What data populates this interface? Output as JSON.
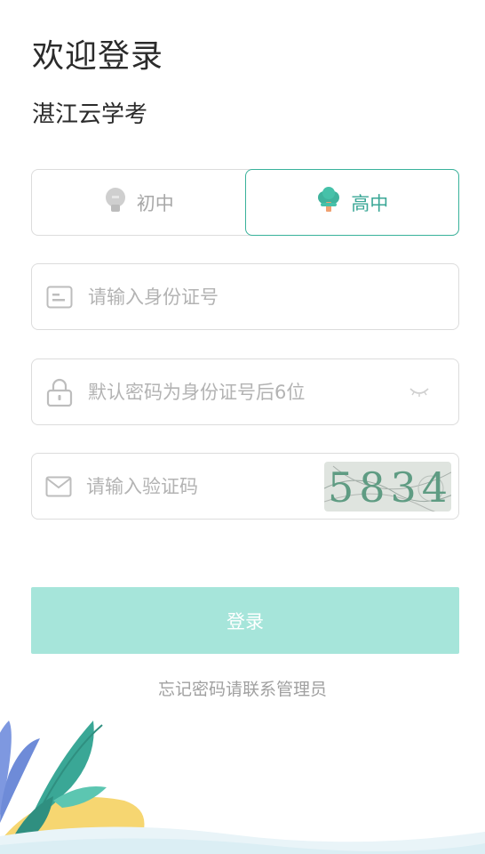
{
  "header": {
    "title": "欢迎登录",
    "subtitle": "湛江云学考"
  },
  "level_tabs": [
    {
      "label": "初中",
      "icon": "lightbulb-icon",
      "active": false
    },
    {
      "label": "高中",
      "icon": "tree-icon",
      "active": true
    }
  ],
  "form": {
    "id_placeholder": "请输入身份证号",
    "id_value": "",
    "password_placeholder": "默认密码为身份证号后6位",
    "password_value": "",
    "code_placeholder": "请输入验证码",
    "code_value": "",
    "captcha_text": "5834"
  },
  "login_button": "登录",
  "forgot_text": "忘记密码请联系管理员",
  "colors": {
    "accent": "#3aa796",
    "button_bg": "#a6e5da",
    "border": "#dcdcdc",
    "placeholder": "#b3b3b3"
  }
}
